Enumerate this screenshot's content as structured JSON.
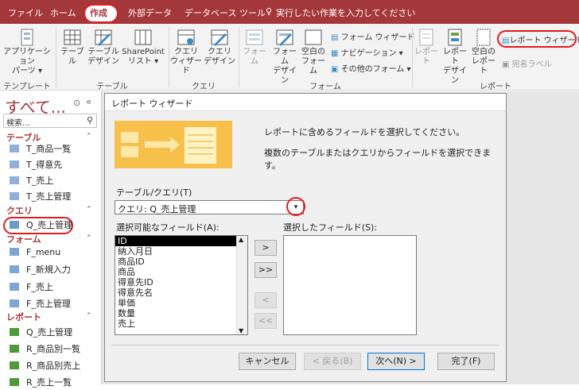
{
  "tabs": [
    "ファイル",
    "ホーム",
    "作成",
    "外部データ",
    "データベース ツール",
    "実行したい作業を入力してください"
  ],
  "ribbon": {
    "app_parts_1": "アプリケーション",
    "app_parts_2": "パーツ ▾",
    "table": "テーブル",
    "table_design_1": "テーブル",
    "table_design_2": "デザイン",
    "sharepoint_1": "SharePoint",
    "sharepoint_2": "リスト ▾",
    "query_wizard_1": "クエリ",
    "query_wizard_2": "ウィザード",
    "query_design_1": "クエリ",
    "query_design_2": "デザイン",
    "form": "フォーム",
    "form_design_1": "フォーム",
    "form_design_2": "デザイン",
    "blank_form_1": "空白の",
    "blank_form_2": "フォーム",
    "form_wizard": "フォーム ウィザード",
    "navigation": "ナビゲーション ▾",
    "other_forms": "その他のフォーム ▾",
    "report": "レポート",
    "report_design_1": "レポート",
    "report_design_2": "デザイン",
    "blank_report_1": "空白の",
    "blank_report_2": "レポート",
    "report_wizard": "レポート ウィザード",
    "labels": "宛名ラベル",
    "groups": [
      "テンプレート",
      "テーブル",
      "クエリ",
      "フォーム",
      "レポート"
    ]
  },
  "nav": {
    "header": "すべて...",
    "search": "検索...",
    "cat_tables": "テーブル",
    "tables": [
      "T_商品一覧",
      "T_得意先",
      "T_売上",
      "T_売上管理"
    ],
    "cat_queries": "クエリ",
    "queries": [
      "Q_売上管理"
    ],
    "cat_forms": "フォーム",
    "forms": [
      "F_menu",
      "F_新規入力",
      "F_売上",
      "F_売上管理"
    ],
    "cat_reports": "レポート",
    "reports": [
      "Q_売上管理",
      "R_商品別一覧",
      "R_商品別売上",
      "R_売上一覧"
    ]
  },
  "dialog": {
    "title": "レポート ウィザード",
    "desc1": "レポートに含めるフィールドを選択してください。",
    "desc2": "複数のテーブルまたはクエリからフィールドを選択できます。",
    "table_query_label": "テーブル/クエリ(T)",
    "combo_value": "クエリ: Q_売上管理",
    "available_label": "選択可能なフィールド(A):",
    "selected_label": "選択したフィールド(S):",
    "available_fields": [
      "ID",
      "納入月日",
      "商品ID",
      "商品",
      "得意先ID",
      "得意先名",
      "単価",
      "数量",
      "売上"
    ],
    "btn_add": ">",
    "btn_add_all": ">>",
    "btn_remove": "<",
    "btn_remove_all": "<<",
    "cancel": "キャンセル",
    "back": "< 戻る(B)",
    "next": "次へ(N) >",
    "finish": "完了(F)"
  },
  "colors": {
    "accent": "#a4373a",
    "highlight": "#e21c1c"
  }
}
